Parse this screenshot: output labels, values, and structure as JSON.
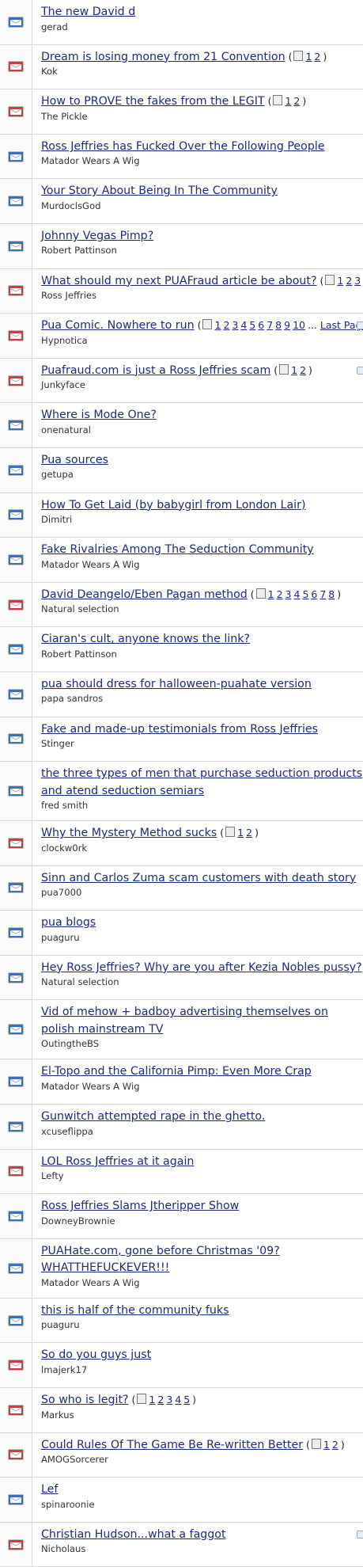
{
  "colors": {
    "link": "#1b2b7a",
    "hot_icon": "#e0343c",
    "normal_icon": "#2f73c9"
  },
  "topics": [
    {
      "title": "The new David d",
      "author": "gerad",
      "icon": "normal"
    },
    {
      "title": "Dream is losing money from 21 Convention",
      "author": "Kok",
      "icon": "hot",
      "pages": [
        "1",
        "2"
      ]
    },
    {
      "title": "How to PROVE the fakes from the LEGIT",
      "author": "The Pickle",
      "icon": "hot",
      "pages": [
        "1",
        "2"
      ]
    },
    {
      "title": "Ross Jeffries has Fucked Over the Following People",
      "author": "Matador Wears A Wig",
      "icon": "normal"
    },
    {
      "title": "Your Story About Being In The Community",
      "author": "MurdoclsGod",
      "icon": "normal"
    },
    {
      "title": "Johnny Vegas Pimp?",
      "author": "Robert Pattinson",
      "icon": "normal"
    },
    {
      "title": "What should my next PUAFraud article be about?",
      "author": "Ross Jeffries",
      "icon": "hot",
      "pages": [
        "1",
        "2",
        "3"
      ]
    },
    {
      "title": "Pua Comic. Nowhere to run",
      "author": "Hypnotica",
      "icon": "hot",
      "pages": [
        "1",
        "2",
        "3",
        "4",
        "5",
        "6",
        "7",
        "8",
        "9",
        "10"
      ],
      "last_page": "Last Page",
      "edge": true
    },
    {
      "title": "Puafraud.com is just a Ross Jeffries scam",
      "author": "Junkyface",
      "icon": "hot",
      "pages": [
        "1",
        "2"
      ],
      "edge": true
    },
    {
      "title": "Where is Mode One?",
      "author": "onenatural",
      "icon": "normal"
    },
    {
      "title": "Pua sources",
      "author": "getupa",
      "icon": "normal"
    },
    {
      "title": "How To Get Laid (by babygirl from London Lair)",
      "author": "Dimitri",
      "icon": "normal"
    },
    {
      "title": "Fake Rivalries Among The Seduction Community",
      "author": "Matador Wears A Wig",
      "icon": "normal"
    },
    {
      "title": "David Deangelo/Eben Pagan method",
      "author": "Natural selection",
      "icon": "hot",
      "pages": [
        "1",
        "2",
        "3",
        "4",
        "5",
        "6",
        "7",
        "8"
      ]
    },
    {
      "title": "Ciaran's cult, anyone knows the link?",
      "author": "Robert Pattinson",
      "icon": "normal"
    },
    {
      "title": "pua should dress for halloween-puahate version",
      "author": "papa sandros",
      "icon": "normal"
    },
    {
      "title": "Fake and made-up testimonials from Ross Jeffries",
      "author": "Stinger",
      "icon": "normal"
    },
    {
      "title": "the three types of men that purchase seduction products and atend seduction semiars",
      "author": "fred smith",
      "icon": "normal",
      "tall": true
    },
    {
      "title": "Why the Mystery Method sucks",
      "author": "clockw0rk",
      "icon": "hot",
      "pages": [
        "1",
        "2"
      ]
    },
    {
      "title": "Sinn and Carlos Zuma scam customers with death story",
      "author": "pua7000",
      "icon": "normal"
    },
    {
      "title": "pua blogs",
      "author": "puaguru",
      "icon": "normal"
    },
    {
      "title": "Hey Ross Jeffries? Why are you after Kezia Nobles pussy?",
      "author": "Natural selection",
      "icon": "normal"
    },
    {
      "title": "Vid of mehow + badboy advertising themselves on polish mainstream TV",
      "author": "OutingtheBS",
      "icon": "normal",
      "tall": true
    },
    {
      "title": "El-Topo and the California Pimp: Even More Crap",
      "author": "Matador Wears A Wig",
      "icon": "normal"
    },
    {
      "title": "Gunwitch attempted rape in the ghetto.",
      "author": "xcuseflippa",
      "icon": "normal"
    },
    {
      "title": "LOL Ross Jeffries at it again",
      "author": "Lefty",
      "icon": "hot"
    },
    {
      "title": "Ross Jeffries Slams Jtheripper Show",
      "author": "DowneyBrownie",
      "icon": "normal"
    },
    {
      "title": "PUAHate.com, gone before Christmas '09? WHATTHEFUCKEVER!!!",
      "author": "Matador Wears A Wig",
      "icon": "normal",
      "tall": true
    },
    {
      "title": "this is half of the community fuks",
      "author": "puaguru",
      "icon": "normal"
    },
    {
      "title": "So do you guys just",
      "author": "lmajerk17",
      "icon": "hot"
    },
    {
      "title": "So who is legit?",
      "author": "Markus",
      "icon": "hot",
      "pages": [
        "1",
        "2",
        "3",
        "4",
        "5"
      ]
    },
    {
      "title": "Could Rules Of The Game Be Re-written Better",
      "author": "AMOGSorcerer",
      "icon": "hot",
      "pages": [
        "1",
        "2"
      ]
    },
    {
      "title": "Lef",
      "author": "spinaroonie",
      "icon": "normal"
    },
    {
      "title": "Christian Hudson...what a faggot",
      "author": "Nicholaus",
      "icon": "hot",
      "edge": true
    }
  ]
}
